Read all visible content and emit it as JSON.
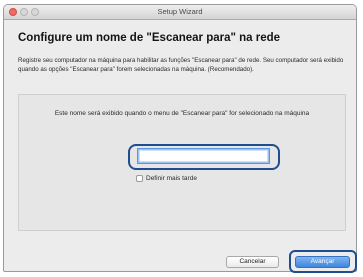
{
  "window": {
    "title": "Setup Wizard"
  },
  "page": {
    "heading": "Configure um nome de \"Escanear para\" na rede",
    "description": "Registre seu computador na máquina para habilitar as funções \"Escanear para\" de rede. Seu computador será exibido quando as opções \"Escanear para\" forem selecionadas na máquina. (Recomendado)."
  },
  "panel": {
    "text": "Este nome será exibido quando o menu de \"Escanear para\" for selecionado na máquina",
    "name_value": "",
    "later_label": "Definir mais tarde",
    "later_checked": false
  },
  "buttons": {
    "cancel": "Cancelar",
    "next": "Avançar"
  },
  "colors": {
    "highlight_ring": "#1f4d8f",
    "primary_button": "#3f86dd",
    "close_button": "#f16b63"
  }
}
